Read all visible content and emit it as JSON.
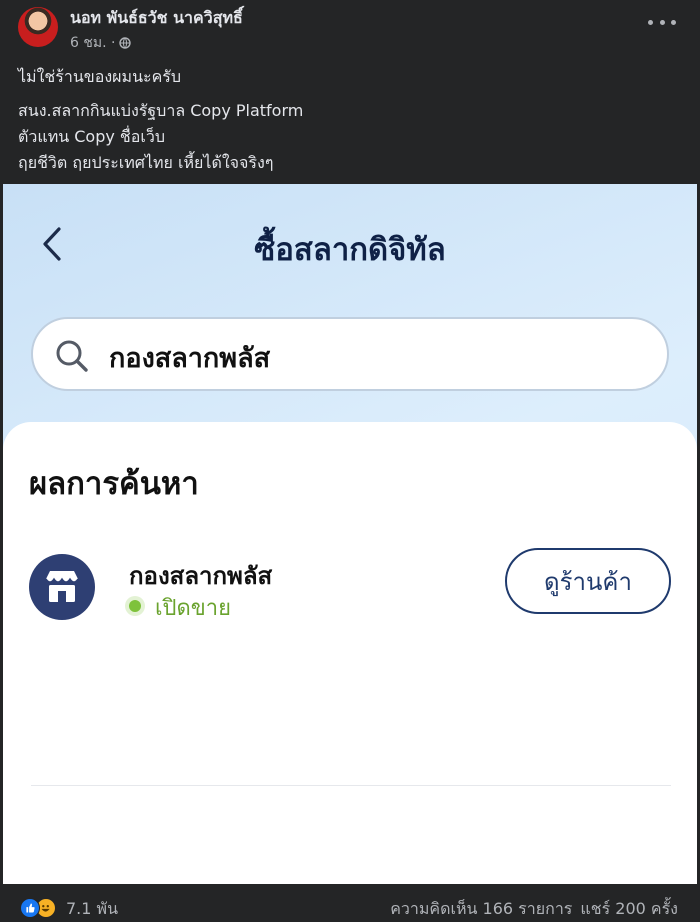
{
  "post": {
    "author": "นอท พันธ์ธวัช นาควิสุทธิ์",
    "time": "6 ชม. ·",
    "globe_icon": "globe-icon",
    "more_icon": "more-icon",
    "lines": [
      "ไม่ใช่ร้านของผมนะครับ",
      "สนง.สลากกินแบ่งรัฐบาล Copy Platform",
      "ตัวแทน Copy ชื่อเว็บ",
      "ฤยชีวิต ฤยประเทศไทย เหี้ยได้ใจจริงๆ"
    ]
  },
  "app": {
    "title": "ซื้อสลากดิจิทัล",
    "back_icon": "chevron-left-icon",
    "search": {
      "icon": "search-icon",
      "value": "กองสลากพลัส"
    },
    "results_heading": "ผลการค้นหา",
    "results": [
      {
        "icon": "store-icon",
        "name": "กองสลากพลัส",
        "status": "เปิดขาย",
        "status_color": "#7ec23b",
        "button_label": "ดูร้านค้า"
      }
    ],
    "colors": {
      "navy": "#0f2146",
      "button_border": "#1f3a6d",
      "shop_icon_bg": "#2e3f73"
    }
  },
  "footer": {
    "reactions": [
      "like-icon",
      "haha-icon"
    ],
    "reaction_count": "7.1 พัน",
    "comments": "ความคิดเห็น 166 รายการ",
    "shares": "แชร์ 200 ครั้ง"
  }
}
